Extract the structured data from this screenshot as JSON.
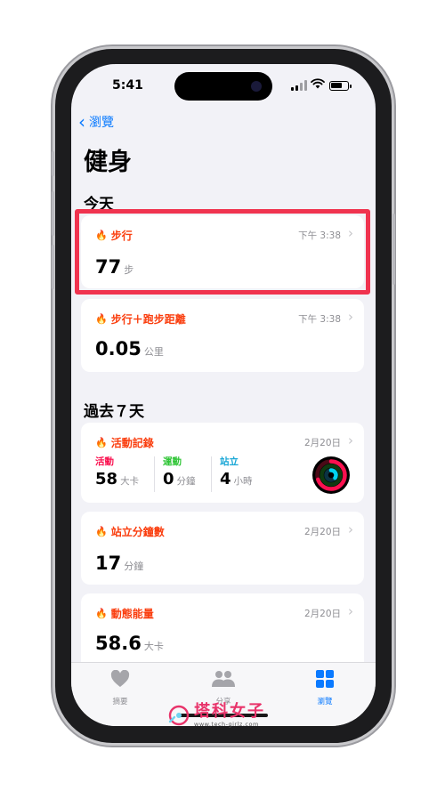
{
  "status": {
    "time": "5:41",
    "battery_level": 0.7
  },
  "nav": {
    "back_label": "瀏覽",
    "title": "健身"
  },
  "sections": {
    "today": "今天",
    "past7": "過去７天"
  },
  "cards": {
    "walking": {
      "title": "步行",
      "time": "下午 3:38",
      "value": "77",
      "unit": "步"
    },
    "distance": {
      "title": "步行＋跑步距離",
      "time": "下午 3:38",
      "value": "0.05",
      "unit": "公里"
    },
    "activity": {
      "title": "活動記錄",
      "date": "2月20日",
      "metrics": [
        {
          "label": "活動",
          "value": "58",
          "unit": "大卡",
          "color": "#fa114f"
        },
        {
          "label": "運動",
          "value": "0",
          "unit": "分鐘",
          "color": "#2fc536"
        },
        {
          "label": "站立",
          "value": "4",
          "unit": "小時",
          "color": "#1aa7d6"
        }
      ]
    },
    "stand": {
      "title": "站立分鐘數",
      "date": "2月20日",
      "value": "17",
      "unit": "分鐘"
    },
    "energy": {
      "title": "動態能量",
      "date": "2月20日",
      "value": "58.6",
      "unit": "大卡"
    }
  },
  "tabs": [
    {
      "label": "摘要",
      "icon": "heart-icon",
      "active": false
    },
    {
      "label": "分享",
      "icon": "people-icon",
      "active": false
    },
    {
      "label": "瀏覽",
      "icon": "grid-icon",
      "active": true
    }
  ],
  "watermark": {
    "main": "塔科女子",
    "sub": "www.tech-girlz.com"
  },
  "colors": {
    "accent": "#0a7aff",
    "health_orange": "#fa3c0c",
    "highlight": "#f0334f",
    "brand_pink": "#e8336a"
  }
}
